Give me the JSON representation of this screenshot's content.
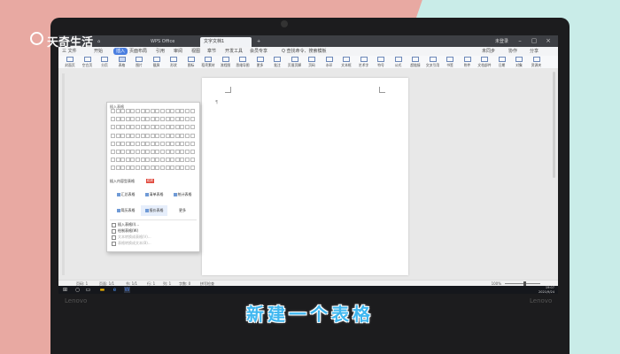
{
  "watermark": {
    "text": "天奇生活"
  },
  "caption": {
    "text": "新建一个表格"
  },
  "laptop": {
    "brand": "Lenovo"
  },
  "app": {
    "title_bar": {
      "tabs": [
        {
          "label": "WPS Office"
        },
        {
          "label": "文字文档1"
        }
      ],
      "user": "未登录"
    },
    "menu": {
      "items": [
        "三 文件",
        "开始",
        "插入",
        "页面布局",
        "引用",
        "审阅",
        "视图",
        "章节",
        "开发工具",
        "会员专享",
        "Q 查找命令、搜索模板"
      ],
      "active_index": 2,
      "right": [
        "未同步",
        "协作",
        "分享"
      ]
    },
    "ribbon": {
      "active_index": 3,
      "buttons": [
        "封面页",
        "空白页",
        "分页",
        "表格",
        "图片",
        "截屏",
        "形状",
        "图标",
        "稻壳素材",
        "流程图",
        "思维导图",
        "更多",
        "批注",
        "页眉页脚",
        "页码",
        "水印",
        "文本框",
        "艺术字",
        "符号",
        "公式",
        "超链接",
        "交叉引用",
        "书签",
        "附件",
        "文档部件",
        "日期",
        "对象",
        "资源夹"
      ]
    },
    "table_dropdown": {
      "header": "插入表格",
      "grid_rows": 8,
      "grid_cols": 17,
      "section_label": "插入内容型表格",
      "section_badge": "稻壳",
      "options": [
        "汇总表格",
        "清单表格",
        "统计表格",
        "简历表格",
        "报价表格",
        "更多"
      ],
      "highlighted_option_index": 4,
      "menu_items": [
        {
          "label": "插入表格(I)...",
          "disabled": false
        },
        {
          "label": "绘制表格(W)",
          "disabled": false
        },
        {
          "label": "文本转换成表格(V)...",
          "disabled": true
        },
        {
          "label": "表格转换成文本(B)...",
          "disabled": true
        }
      ]
    },
    "status_bar": {
      "page": "页码: 1",
      "pages": "页面: 1/1",
      "section": "节: 1/1",
      "row": "行: 1",
      "column": "列: 1",
      "words": "字数: 0",
      "spell": "拼写检查",
      "zoom": "100%"
    },
    "taskbar": {
      "time": "19:07",
      "date": "2021/9/24"
    }
  },
  "colors": {
    "accent": "#4a7ee0",
    "caption": "#3fb7f0",
    "bg_left": "#e8a9a2",
    "bg_right": "#c9ece8"
  }
}
